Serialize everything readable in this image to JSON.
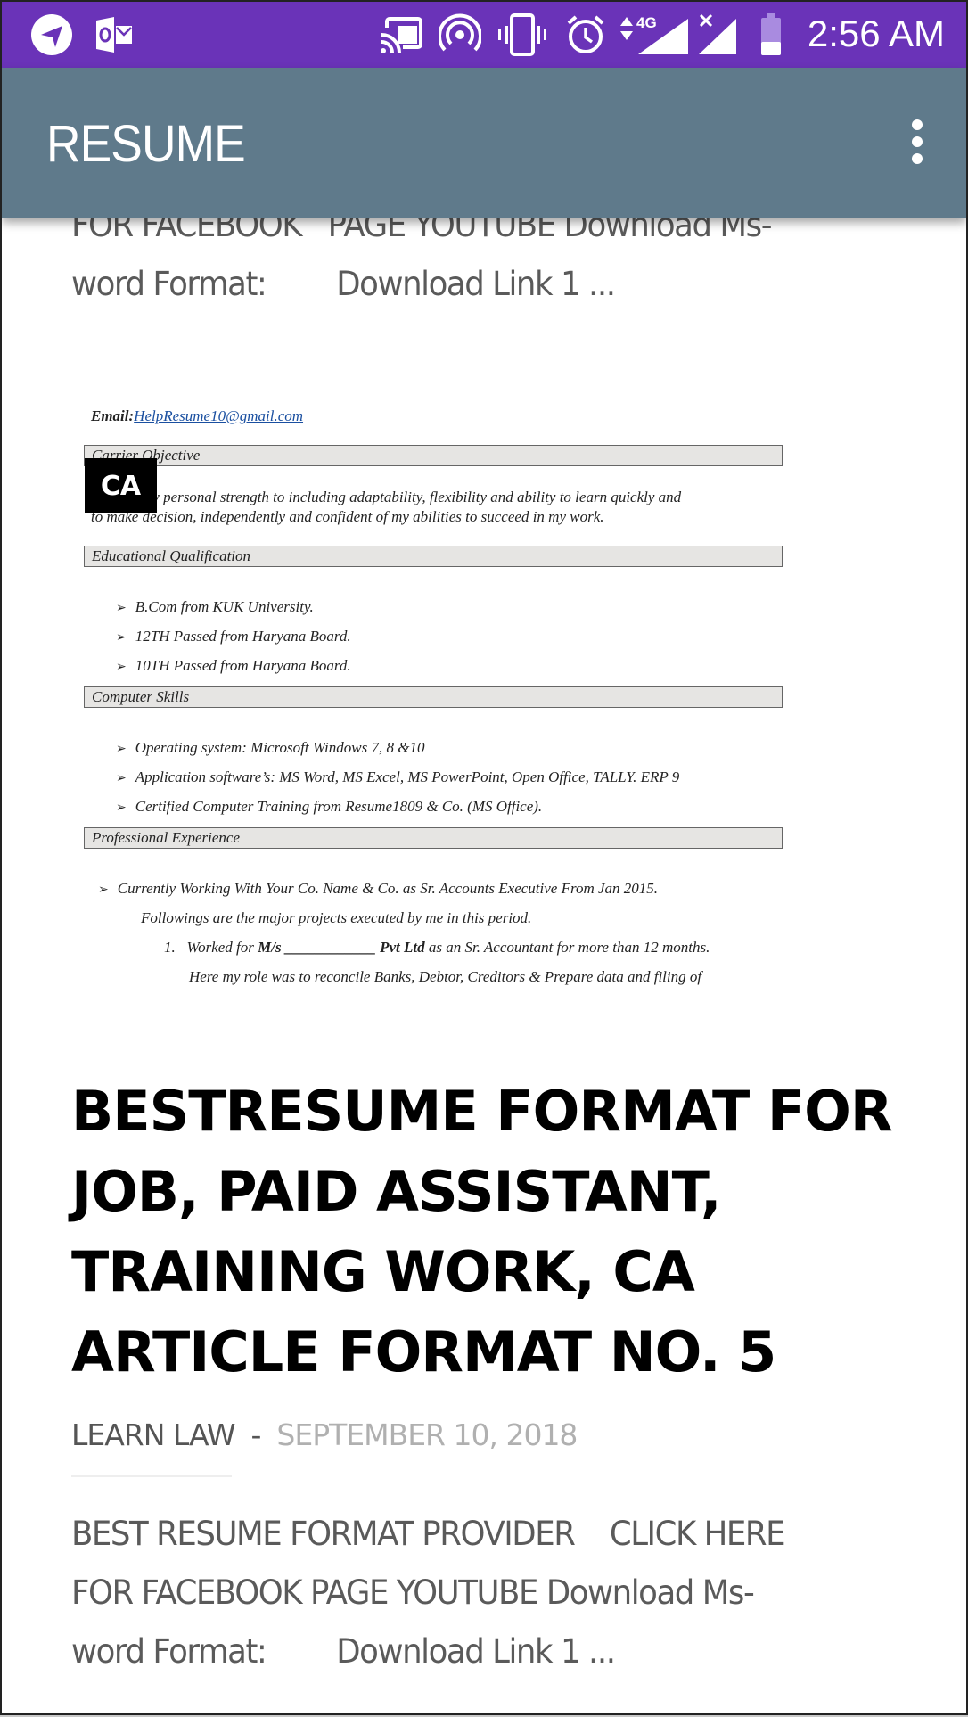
{
  "status_bar": {
    "left_icons": [
      "navigation-arrow-icon",
      "outlook-icon"
    ],
    "right_icons": [
      "cast-icon",
      "hotspot-icon",
      "vibrate-icon",
      "alarm-icon",
      "data-4g-icon",
      "signal-icon",
      "no-signal-icon",
      "battery-icon"
    ],
    "network_label": "4G",
    "time": "2:56 AM"
  },
  "app_bar": {
    "title": "RESUME",
    "menu_icon": "more-vert-icon"
  },
  "previous_post": {
    "excerpt_lines": [
      "FOR FACEBOOK   PAGE YOUTUBE Download Ms-",
      "word Format:        Download Link 1 ..."
    ]
  },
  "thumbnail": {
    "badge": "CA",
    "email_label": "Email:",
    "email": "HelpResume10@gmail.com",
    "sections": [
      {
        "heading": "Carrier Objective",
        "paragraph": [
          "To offer my personal strength to including adaptability, flexibility and ability to learn quickly and",
          "to make decision, independently and confident of my abilities to succeed in my work."
        ]
      },
      {
        "heading": "Educational Qualification",
        "bullets": [
          "B.Com from  KUK University.",
          "12TH Passed from Haryana Board.",
          "10TH Passed from Haryana Board."
        ]
      },
      {
        "heading": "Computer Skills",
        "bullets": [
          "Operating system: Microsoft Windows 7, 8 &10",
          "Application software’s: MS Word, MS Excel, MS PowerPoint, Open Office, TALLY. ERP 9",
          "Certified Computer Training from Resume1809 & Co. (MS Office)."
        ]
      },
      {
        "heading": "Professional Experience",
        "bullets": [
          "Currently Working With  Your Co. Name & Co. as Sr. Accounts Executive  From Jan 2015."
        ],
        "followup": "Followings are the major projects executed by me in this period.",
        "numbered": {
          "num": "1.",
          "pre": "Worked for ",
          "bold1": "M/s ____________ Pvt Ltd",
          "post": " as an Sr. Accountant  for more than 12 months.",
          "line2": "Here my role was to reconcile Banks, Debtor, Creditors & Prepare data and filing of"
        }
      }
    ]
  },
  "post": {
    "title_lines": [
      "BESTRESUME FORMAT FOR",
      "JOB, PAID ASSISTANT,",
      "TRAINING WORK, CA",
      "ARTICLE FORMAT NO. 5"
    ],
    "author": "LEARN LAW",
    "separator": "-",
    "date": "SEPTEMBER 10, 2018",
    "excerpt_lines": [
      "BEST RESUME FORMAT PROVIDER    CLICK HERE",
      "FOR FACEBOOK PAGE YOUTUBE Download Ms-",
      "word Format:        Download Link 1 ..."
    ]
  },
  "colors": {
    "status_bar": "#6a33b8",
    "app_bar": "#5f7a8b",
    "date_text": "#b0b0b0",
    "body_text": "#5a5a5a"
  }
}
